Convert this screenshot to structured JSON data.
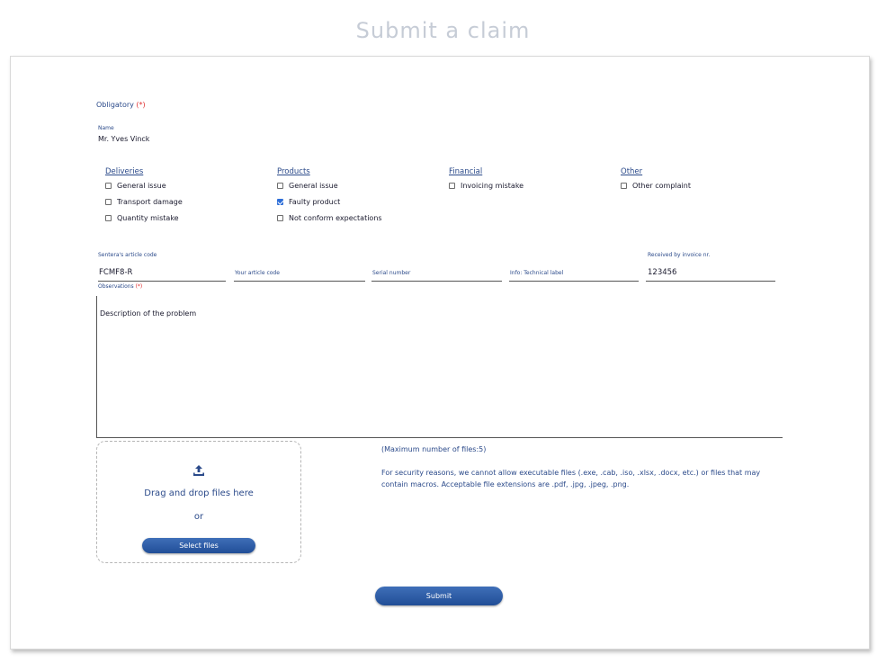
{
  "page_title": "Submit a claim",
  "form": {
    "obligatory_label": "Obligatory",
    "required_marker": "(*)",
    "name_label": "Name",
    "name_value": "Mr. Yves Vinck",
    "categories": [
      {
        "title": "Deliveries",
        "options": [
          {
            "label": "General issue",
            "checked": false
          },
          {
            "label": "Transport damage",
            "checked": false
          },
          {
            "label": "Quantity mistake",
            "checked": false
          }
        ]
      },
      {
        "title": "Products",
        "options": [
          {
            "label": "General issue",
            "checked": false
          },
          {
            "label": "Faulty product",
            "checked": true
          },
          {
            "label": "Not conform expectations",
            "checked": false
          }
        ]
      },
      {
        "title": "Financial",
        "options": [
          {
            "label": "Invoicing mistake",
            "checked": false
          }
        ]
      },
      {
        "title": "Other",
        "options": [
          {
            "label": "Other complaint",
            "checked": false
          }
        ]
      }
    ],
    "article_code_label": "Sentera's article code",
    "article_code_value": "FCMF8-R",
    "your_article_code_placeholder": "Your article code",
    "serial_number_placeholder": "Serial number",
    "technical_label_placeholder": "Info: Technical label",
    "invoice_label": "Received by invoice nr.",
    "invoice_value": "123456",
    "observations_label": "Observations",
    "observations_value": "Description of the problem",
    "upload": {
      "drag_text": "Drag and drop files here",
      "or_text": "or",
      "select_button": "Select files",
      "icon": "upload-icon"
    },
    "max_files_note": "(Maximum number of files:5)",
    "security_note": "For security reasons, we cannot allow executable files (.exe, .cab, .iso, .xlsx, .docx, etc.) or files that may contain macros. Acceptable file extensions are .pdf, .jpg, .jpeg, .png.",
    "submit_button": "Submit"
  },
  "colors": {
    "label_blue": "#2b4a8a",
    "required_red": "#e03030",
    "button_blue": "#214e97",
    "checkbox_checked": "#2f6fd8",
    "title_gray": "#c6ccd6"
  }
}
